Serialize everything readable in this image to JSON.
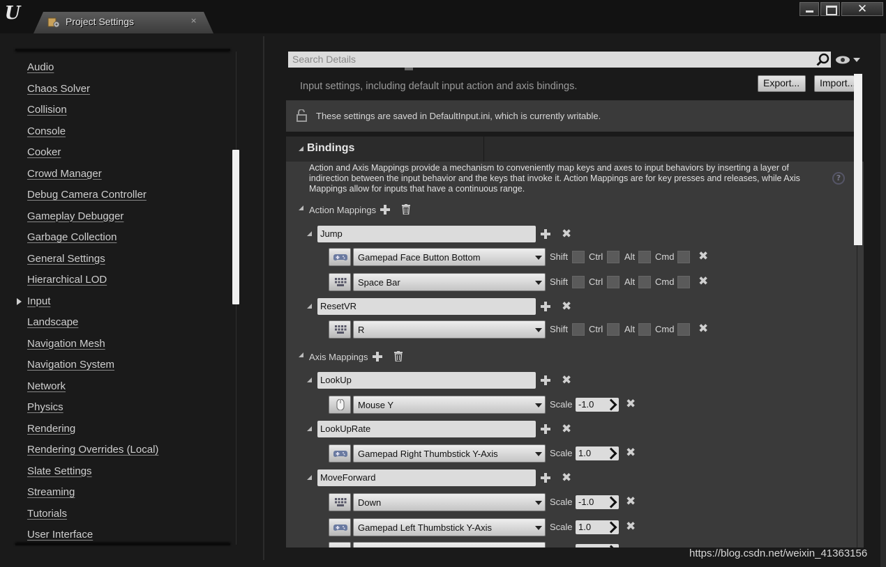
{
  "window": {
    "tab_title": "Project Settings",
    "tab_close": "×"
  },
  "sidebar": {
    "items": [
      {
        "label": "Audio"
      },
      {
        "label": "Chaos Solver"
      },
      {
        "label": "Collision"
      },
      {
        "label": "Console"
      },
      {
        "label": "Cooker"
      },
      {
        "label": "Crowd Manager"
      },
      {
        "label": "Debug Camera Controller"
      },
      {
        "label": "Gameplay Debugger"
      },
      {
        "label": "Garbage Collection"
      },
      {
        "label": "General Settings"
      },
      {
        "label": "Hierarchical LOD"
      },
      {
        "label": "Input"
      },
      {
        "label": "Landscape"
      },
      {
        "label": "Navigation Mesh"
      },
      {
        "label": "Navigation System"
      },
      {
        "label": "Network"
      },
      {
        "label": "Physics"
      },
      {
        "label": "Rendering"
      },
      {
        "label": "Rendering Overrides (Local)"
      },
      {
        "label": "Slate Settings"
      },
      {
        "label": "Streaming"
      },
      {
        "label": "Tutorials"
      },
      {
        "label": "User Interface"
      }
    ],
    "selected": "Input"
  },
  "details": {
    "search_placeholder": "Search Details",
    "subtitle": "Input settings, including default input action and axis bindings.",
    "export_label": "Export...",
    "import_label": "Import...",
    "notice": "These settings are saved in DefaultInput.ini, which is currently writable.",
    "section_title": "Bindings",
    "description": "Action and Axis Mappings provide a mechanism to conveniently map keys and axes to input behaviors by inserting a layer of indirection between the input behavior and the keys that invoke it. Action Mappings are for key presses and releases, while Axis Mappings allow for inputs that have a continuous range.",
    "help_glyph": "?",
    "action_label": "Action Mappings",
    "axis_label": "Axis Mappings",
    "modifiers": {
      "shift": "Shift",
      "ctrl": "Ctrl",
      "alt": "Alt",
      "cmd": "Cmd"
    },
    "scale_label": "Scale",
    "actions": [
      {
        "name": "Jump",
        "keys": [
          {
            "key": "Gamepad Face Button Bottom",
            "icon": "gamepad-icon"
          },
          {
            "key": "Space Bar",
            "icon": "keyboard-icon"
          }
        ]
      },
      {
        "name": "ResetVR",
        "keys": [
          {
            "key": "R",
            "icon": "keyboard-icon"
          }
        ]
      }
    ],
    "axes": [
      {
        "name": "LookUp",
        "keys": [
          {
            "key": "Mouse Y",
            "icon": "mouse-icon",
            "scale": "-1.0"
          }
        ]
      },
      {
        "name": "LookUpRate",
        "keys": [
          {
            "key": "Gamepad Right Thumbstick Y-Axis",
            "icon": "gamepad-icon",
            "scale": "1.0"
          }
        ]
      },
      {
        "name": "MoveForward",
        "keys": [
          {
            "key": "Down",
            "icon": "keyboard-icon",
            "scale": "-1.0"
          },
          {
            "key": "Gamepad Left Thumbstick Y-Axis",
            "icon": "gamepad-icon",
            "scale": "1.0"
          }
        ]
      }
    ]
  },
  "watermark": "https://blog.csdn.net/weixin_41363156",
  "colors": {
    "panel": "#3a3a3a",
    "background": "#1a1a1a",
    "field": "#dcdcdc"
  }
}
